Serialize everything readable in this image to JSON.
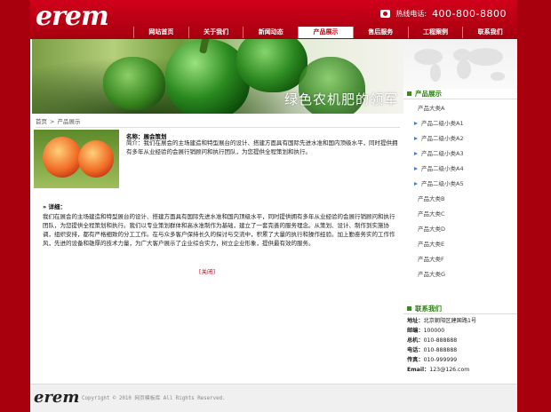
{
  "header": {
    "logo": "erem",
    "hotline_label": "热线电话:",
    "hotline_number": "400-800-8800"
  },
  "nav": [
    "网站首页",
    "关于我们",
    "新闻动态",
    "产品展示",
    "售后服务",
    "工程案例",
    "联系我们"
  ],
  "nav_active_index": 3,
  "banner": {
    "slogan": "绿色农机肥的领军"
  },
  "breadcrumb": {
    "home": "首页",
    "separator": ">",
    "current": "产品展示"
  },
  "product": {
    "name_label": "名称：",
    "name": "展会策划",
    "brief_label": "简介：",
    "brief": "我们在展会的主场建造和特型展台的设计、搭建方面具有国际先进水准和国内顶级水平，同时提供拥有多年从业经验的会展行销顾问和执行团队，为您提供全程策划和执行。",
    "detail_heading": "» 详细：",
    "detail": "我们在展会的主场建造和特型展台的设计、搭建方面具有国际先进水准和国内顶级水平，同时提供拥有多年从业经验的会展行销顾问和执行团队，为您提供全程策划和执行。我们以专业策划群体和高水准制作为基础，建立了一套完善的服务理念。从策划、设计、制作到实施协调，组织安排，都有严格细致的分工工作。在与众多客户保持长久的探讨与交流中，积累了大量的执行和操作经验。加上勤奋务实的工作作风，先进的设备和雄厚的技术力量，为广大客户展示了企业综合实力，树立企业形象，提供最有效的服务。",
    "close": "[关闭]"
  },
  "sidebar": {
    "title": "产品展示",
    "categories": [
      {
        "label": "产品大类A",
        "sub": false
      },
      {
        "label": "产品二级小类A1",
        "sub": true
      },
      {
        "label": "产品二级小类A2",
        "sub": true
      },
      {
        "label": "产品二级小类A3",
        "sub": true
      },
      {
        "label": "产品二级小类A4",
        "sub": true
      },
      {
        "label": "产品二级小类A5",
        "sub": true
      },
      {
        "label": "产品大类B",
        "sub": false
      },
      {
        "label": "产品大类C",
        "sub": false
      },
      {
        "label": "产品大类D",
        "sub": false
      },
      {
        "label": "产品大类E",
        "sub": false
      },
      {
        "label": "产品大类F",
        "sub": false
      },
      {
        "label": "产品大类G",
        "sub": false
      }
    ]
  },
  "contact": {
    "title": "联系我们",
    "rows": [
      {
        "label": "地址：",
        "value": "北京朝阳区建国路1号"
      },
      {
        "label": "邮编：",
        "value": "100000"
      },
      {
        "label": "总机：",
        "value": "010-888888"
      },
      {
        "label": "电话：",
        "value": "010-888888"
      },
      {
        "label": "传真：",
        "value": "010-999999"
      },
      {
        "label": "Email：",
        "value": "123@126.com"
      }
    ]
  },
  "footer": {
    "logo": "erem",
    "copyright": "Copyright © 2010 网页模板库 All Rights Reserved."
  },
  "colors": {
    "brand_red": "#c00010",
    "accent_green": "#2e7e12",
    "page_bg": "#a8000c"
  }
}
